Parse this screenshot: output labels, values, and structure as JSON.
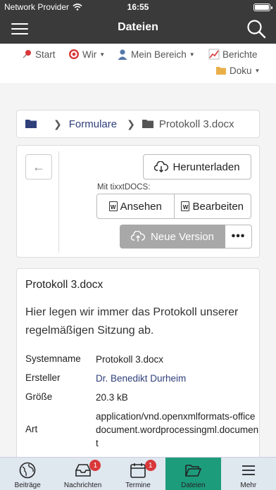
{
  "status_bar": {
    "carrier": "Network Provider",
    "time": "16:55",
    "battery_level": 1.0
  },
  "nav": {
    "title": "Dateien",
    "menu_icon": "hamburger-icon",
    "search_icon": "search-icon"
  },
  "top_menu": {
    "items": [
      {
        "label": "Start",
        "icon": "pin-icon"
      },
      {
        "label": "Wir",
        "icon": "target-icon",
        "has_caret": true
      },
      {
        "label": "Mein Bereich",
        "icon": "user-icon",
        "has_caret": true
      },
      {
        "label": "Berichte",
        "icon": "chart-icon"
      },
      {
        "label": "Doku",
        "icon": "folder-icon",
        "has_caret": true
      }
    ]
  },
  "breadcrumb": {
    "folder_link": "Formulare",
    "current": "Protokoll 3.docx"
  },
  "actions": {
    "download_label": "Herunterladen",
    "tixxt_label": "Mit tixxtDOCS:",
    "view_label": "Ansehen",
    "edit_label": "Bearbeiten",
    "new_version_label": "Neue Version",
    "more_label": "•••"
  },
  "details": {
    "title": "Protokoll 3.docx",
    "description": "Hier legen wir immer das Protokoll unserer regelmäßigen Sitzung ab.",
    "properties": [
      {
        "label": "Systemname",
        "value": "Protokoll 3.docx"
      },
      {
        "label": "Ersteller",
        "value": "Dr. Benedikt Durheim"
      },
      {
        "label": "Größe",
        "value": "20.3 kB"
      },
      {
        "label": "Art",
        "value": "application/vnd.openxmlformats-officedocument.wordprocessingml.document"
      }
    ]
  },
  "tabbar": {
    "tabs": [
      {
        "label": "Beiträge",
        "icon": "globe-icon"
      },
      {
        "label": "Nachrichten",
        "icon": "inbox-icon",
        "badge": "1"
      },
      {
        "label": "Termine",
        "icon": "calendar-icon",
        "badge": "1"
      },
      {
        "label": "Dateien",
        "icon": "folder-open-icon",
        "active": true
      },
      {
        "label": "Mehr",
        "icon": "menu-icon"
      }
    ]
  },
  "colors": {
    "navbar": "#3a3a3a",
    "active_tab": "#1d9c7c",
    "link": "#2f3f7a",
    "badge": "#d9383a"
  }
}
